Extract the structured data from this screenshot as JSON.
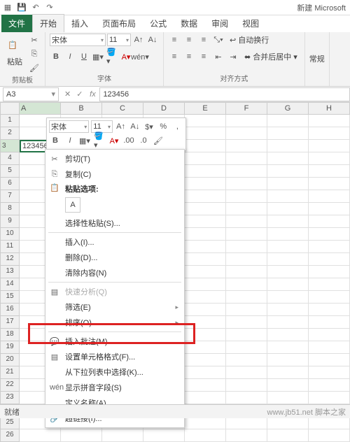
{
  "title": "新建 Microsoft",
  "qat": {
    "save": "💾",
    "undo": "↶",
    "redo": "↷"
  },
  "tabs": [
    "文件",
    "开始",
    "插入",
    "页面布局",
    "公式",
    "数据",
    "审阅",
    "视图"
  ],
  "ribbon": {
    "clipboard": {
      "label": "剪贴板",
      "paste": "粘贴"
    },
    "font": {
      "label": "字体",
      "name": "宋体",
      "size": "11",
      "bold": "B",
      "italic": "I",
      "under": "U"
    },
    "align": {
      "label": "对齐方式",
      "wrap": "自动换行",
      "merge": "合并后居中"
    },
    "style": {
      "label": "常规"
    }
  },
  "namebox": "A3",
  "formula": "123456",
  "cols": [
    "A",
    "B",
    "C",
    "D",
    "E",
    "F",
    "G",
    "H"
  ],
  "rowcount": 26,
  "activeCell": {
    "row": 3,
    "col": 0,
    "value": "123456"
  },
  "mini": {
    "font": "宋体",
    "size": "11",
    "bold": "B",
    "italic": "I"
  },
  "ctx": {
    "cut": "剪切(T)",
    "copy": "复制(C)",
    "pastehdr": "粘贴选项:",
    "pasteopt": "A",
    "pastespec": "选择性粘贴(S)...",
    "insert": "插入(I)...",
    "delete": "删除(D)...",
    "clear": "清除内容(N)",
    "quick": "快速分析(Q)",
    "filter": "筛选(E)",
    "sort": "排序(O)",
    "comment": "插入批注(M)",
    "format": "设置单元格格式(F)...",
    "dropdown": "从下拉列表中选择(K)...",
    "pinyin": "显示拼音字段(S)",
    "name": "定义名称(A)...",
    "link": "超链接(I)..."
  },
  "status": {
    "ready": "就绪",
    "wm": "www.jb51.net 脚本之家"
  }
}
